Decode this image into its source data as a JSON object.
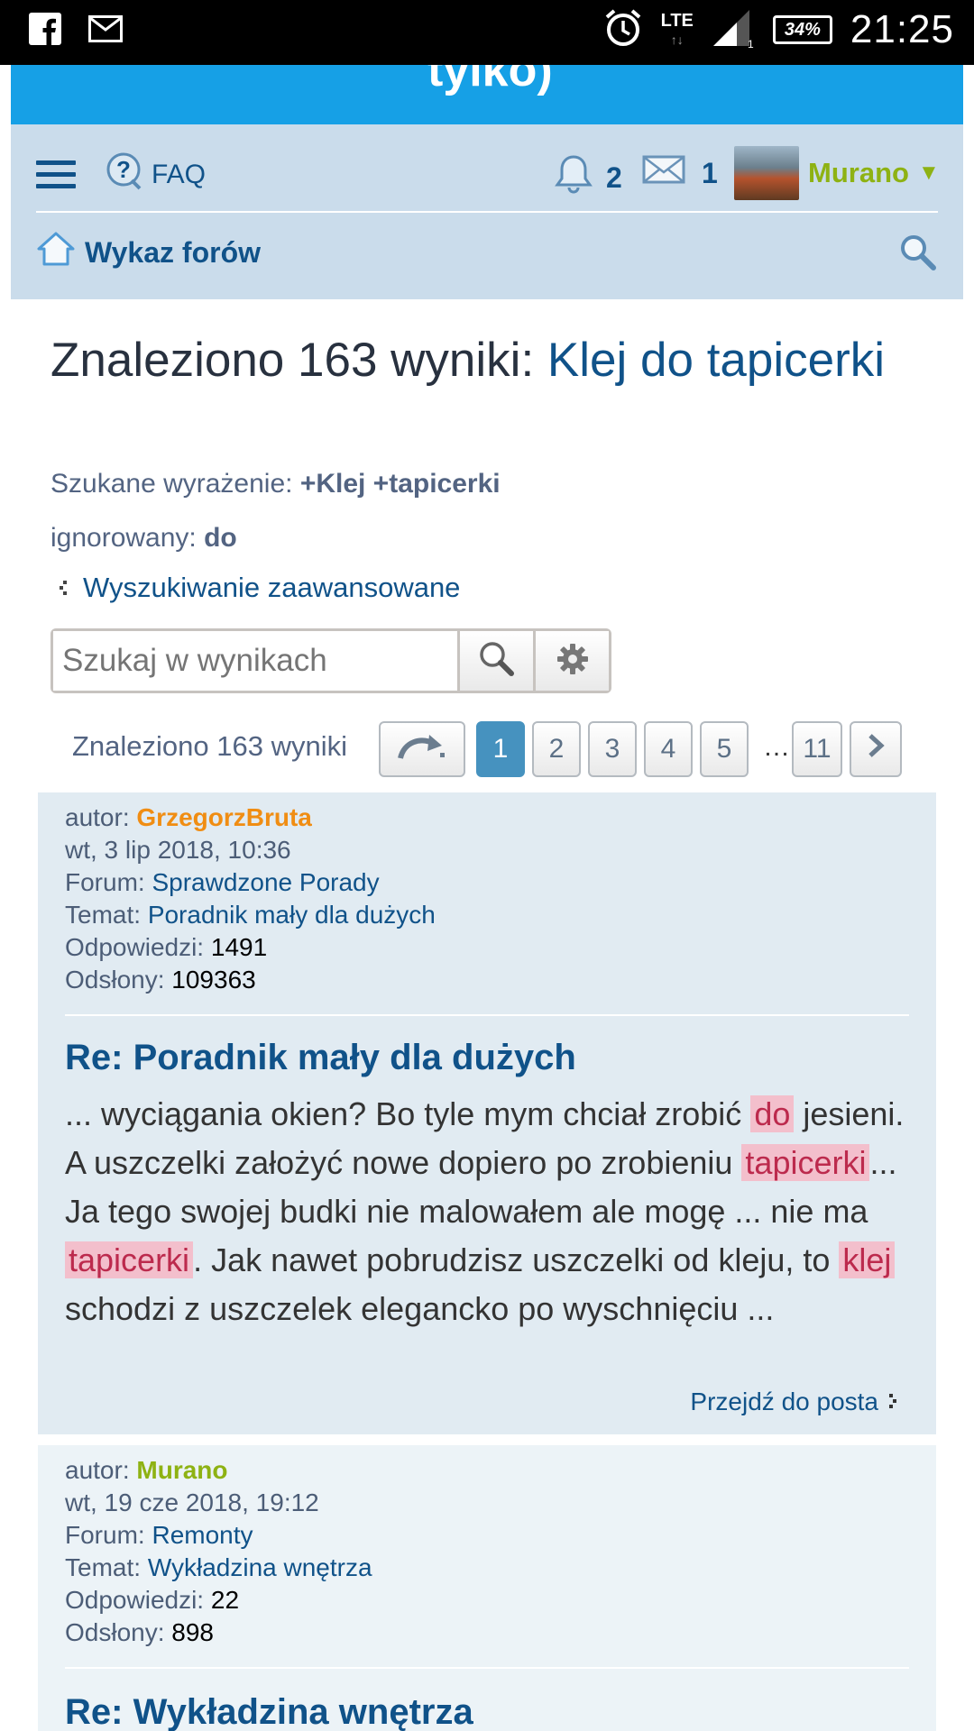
{
  "statusbar": {
    "time": "21:25",
    "network": "LTE",
    "battery": "34%",
    "icons": [
      "facebook-icon",
      "mail-icon",
      "alarm-icon",
      "signal-icon",
      "battery-icon"
    ]
  },
  "banner": {
    "title_fragment": "tylko)"
  },
  "navbar": {
    "faq_label": "FAQ",
    "notifications_count": "2",
    "messages_count": "1",
    "username": "Murano",
    "index_label": "Wykaz forów"
  },
  "search": {
    "heading_prefix": "Znaleziono 163 wyniki: ",
    "heading_query": "Klej do tapicerki",
    "searched_label": "Szukane wyrażenie: ",
    "searched_value": "+Klej +tapicerki",
    "ignored_label": "ignorowany: ",
    "ignored_value": "do",
    "advanced_link": "Wyszukiwanie zaawansowane",
    "input_placeholder": "Szukaj w wynikach"
  },
  "pagination": {
    "count_text": "Znaleziono 163 wyniki",
    "pages": [
      "1",
      "2",
      "3",
      "4",
      "5"
    ],
    "ellipsis": "…",
    "last_page": "11",
    "current": "1"
  },
  "results": [
    {
      "author_label": "autor: ",
      "author": "GrzegorzBruta",
      "date": "wt, 3 lip 2018, 10:36",
      "forum_label": "Forum: ",
      "forum": "Sprawdzone Porady",
      "topic_label": "Temat: ",
      "topic": "Poradnik mały dla dużych",
      "replies_label": "Odpowiedzi: ",
      "replies": "1491",
      "views_label": "Odsłony: ",
      "views": "109363",
      "title": "Re: Poradnik mały dla dużych",
      "excerpt": {
        "t1": "... wyciągania okien? Bo tyle mym chciał zrobić ",
        "h1": "do",
        "t2": " jesieni. A uszczelki założyć nowe dopiero po zrobieniu ",
        "h2": "tapicerki",
        "t3": "... Ja tego swojej budki nie malowałem ale mogę ... nie ma ",
        "h3": "tapicerki",
        "t4": ". Jak nawet pobrudzisz uszczelki od kleju, to ",
        "h4": "klej",
        "t5": " schodzi z uszczelek elegancko po wyschnięciu ..."
      },
      "goto_label": "Przejdź do posta"
    },
    {
      "author_label": "autor: ",
      "author": "Murano",
      "date": "wt, 19 cze 2018, 19:12",
      "forum_label": "Forum: ",
      "forum": "Remonty",
      "topic_label": "Temat: ",
      "topic": "Wykładzina wnętrza",
      "replies_label": "Odpowiedzi: ",
      "replies": "22",
      "views_label": "Odsłony: ",
      "views": "898",
      "title": "Re: Wykładzina wnętrza"
    }
  ],
  "colors": {
    "banner": "#16a0e6",
    "navbar": "#cadceb",
    "link": "#105289",
    "author_orange": "#f08d13",
    "author_green": "#8eb213",
    "highlight_bg": "#f3bfcc",
    "highlight_text": "#bc2a4d",
    "post_bg_1": "#e1ebf2",
    "post_bg_2": "#ecf3f7"
  }
}
